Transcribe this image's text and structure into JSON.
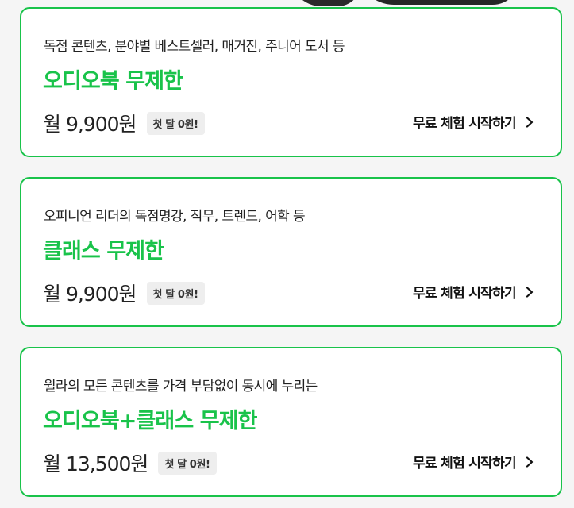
{
  "plans": [
    {
      "subtitle": "독점 콘텐츠, 분야별 베스트셀러, 매거진, 주니어 도서 등",
      "name": "오디오북 무제한",
      "price": "월 9,900원",
      "badge": "첫 달 0원!",
      "cta": "무료 체험 시작하기"
    },
    {
      "subtitle": "오피니언 리더의 독점명강, 직무, 트렌드, 어학 등",
      "name": "클래스 무제한",
      "price": "월 9,900원",
      "badge": "첫 달 0원!",
      "cta": "무료 체험 시작하기"
    },
    {
      "subtitle": "윌라의 모든 콘텐츠를 가격 부담없이 동시에 누리는",
      "name": "오디오북+클래스 무제한",
      "price": "월 13,500원",
      "badge": "첫 달 0원!",
      "cta": "무료 체험 시작하기"
    }
  ],
  "colors": {
    "accent": "#19c34a",
    "text": "#222222",
    "background": "#f5f5f5",
    "badge_bg": "#eeeeee"
  },
  "icons": {
    "cta": "chevron-right-icon"
  }
}
